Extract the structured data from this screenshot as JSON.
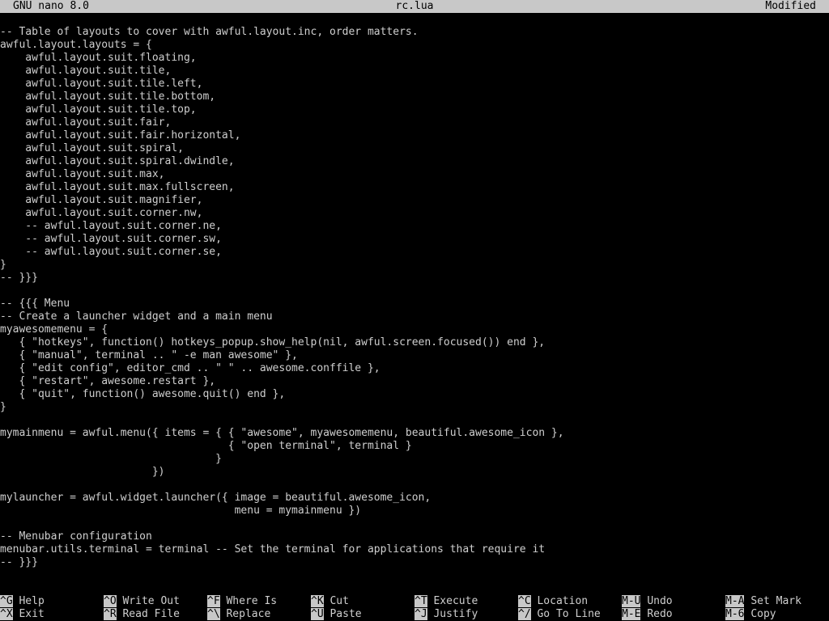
{
  "title_bar": {
    "app": "GNU nano 8.0",
    "filename": "rc.lua",
    "status": "Modified"
  },
  "editor": {
    "lines": [
      "-- Table of layouts to cover with awful.layout.inc, order matters.",
      "awful.layout.layouts = {",
      "    awful.layout.suit.floating,",
      "    awful.layout.suit.tile,",
      "    awful.layout.suit.tile.left,",
      "    awful.layout.suit.tile.bottom,",
      "    awful.layout.suit.tile.top,",
      "    awful.layout.suit.fair,",
      "    awful.layout.suit.fair.horizontal,",
      "    awful.layout.suit.spiral,",
      "    awful.layout.suit.spiral.dwindle,",
      "    awful.layout.suit.max,",
      "    awful.layout.suit.max.fullscreen,",
      "    awful.layout.suit.magnifier,",
      "    awful.layout.suit.corner.nw,",
      "    -- awful.layout.suit.corner.ne,",
      "    -- awful.layout.suit.corner.sw,",
      "    -- awful.layout.suit.corner.se,",
      "}",
      "-- }}}",
      "",
      "-- {{{ Menu",
      "-- Create a launcher widget and a main menu",
      "myawesomemenu = {",
      "   { \"hotkeys\", function() hotkeys_popup.show_help(nil, awful.screen.focused()) end },",
      "   { \"manual\", terminal .. \" -e man awesome\" },",
      "   { \"edit config\", editor_cmd .. \" \" .. awesome.conffile },",
      "   { \"restart\", awesome.restart },",
      "   { \"quit\", function() awesome.quit() end },",
      "}",
      "",
      "mymainmenu = awful.menu({ items = { { \"awesome\", myawesomemenu, beautiful.awesome_icon },",
      "                                    { \"open terminal\", terminal }",
      "                                  }",
      "                        })",
      "",
      "mylauncher = awful.widget.launcher({ image = beautiful.awesome_icon,",
      "                                     menu = mymainmenu })",
      "",
      "-- Menubar configuration",
      "menubar.utils.terminal = terminal -- Set the terminal for applications that require it",
      "-- }}}"
    ]
  },
  "shortcuts": {
    "row1": [
      {
        "key": "^G",
        "label": "Help"
      },
      {
        "key": "^O",
        "label": "Write Out"
      },
      {
        "key": "^F",
        "label": "Where Is"
      },
      {
        "key": "^K",
        "label": "Cut"
      },
      {
        "key": "^T",
        "label": "Execute"
      },
      {
        "key": "^C",
        "label": "Location"
      },
      {
        "key": "M-U",
        "label": "Undo"
      },
      {
        "key": "M-A",
        "label": "Set Mark"
      }
    ],
    "row2": [
      {
        "key": "^X",
        "label": "Exit"
      },
      {
        "key": "^R",
        "label": "Read File"
      },
      {
        "key": "^\\",
        "label": "Replace"
      },
      {
        "key": "^U",
        "label": "Paste"
      },
      {
        "key": "^J",
        "label": "Justify"
      },
      {
        "key": "^/",
        "label": "Go To Line"
      },
      {
        "key": "M-E",
        "label": "Redo"
      },
      {
        "key": "M-6",
        "label": "Copy"
      }
    ]
  },
  "colors": {
    "background": "#000000",
    "text": "#cfcfcf",
    "bar": "#c8c8c8",
    "bar_text": "#000000"
  }
}
